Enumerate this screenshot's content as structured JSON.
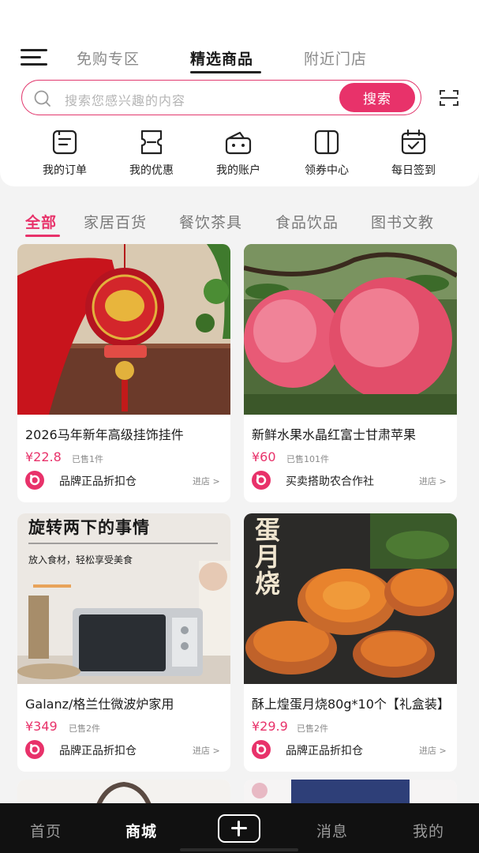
{
  "header": {
    "tabs": [
      {
        "label": "免购专区",
        "active": false
      },
      {
        "label": "精选商品",
        "active": true
      },
      {
        "label": "附近门店",
        "active": false
      }
    ]
  },
  "search": {
    "placeholder": "搜索您感兴趣的内容",
    "button_label": "搜索"
  },
  "quick_actions": [
    {
      "label": "我的订单",
      "icon": "order-icon"
    },
    {
      "label": "我的优惠",
      "icon": "coupon-icon"
    },
    {
      "label": "我的账户",
      "icon": "wallet-icon"
    },
    {
      "label": "领券中心",
      "icon": "ticket-icon"
    },
    {
      "label": "每日签到",
      "icon": "calendar-check-icon"
    }
  ],
  "categories": [
    {
      "label": "全部",
      "active": true
    },
    {
      "label": "家居百货",
      "active": false
    },
    {
      "label": "餐饮茶具",
      "active": false
    },
    {
      "label": "食品饮品",
      "active": false
    },
    {
      "label": "图书文教",
      "active": false
    }
  ],
  "products": [
    {
      "title": "2026马年新年高级挂饰挂件",
      "price": "¥22.8",
      "sold": "已售1件",
      "store": "品牌正品折扣仓",
      "enter": "进店 >"
    },
    {
      "title": "新鲜水果水晶红富士甘肃苹果",
      "price": "¥60",
      "sold": "已售101件",
      "store": "买卖搭助农合作社",
      "enter": "进店 >"
    },
    {
      "title": "Galanz/格兰仕微波炉家用",
      "price": "¥349",
      "sold": "已售2件",
      "store": "品牌正品折扣仓",
      "enter": "进店 >",
      "image_text": {
        "headline": "旋转两下的事情",
        "subline": "放入食材，轻松享受美食"
      }
    },
    {
      "title": "酥上煌蛋月烧80g*10个【礼盒装】",
      "price": "¥29.9",
      "sold": "已售2件",
      "store": "品牌正品折扣仓",
      "enter": "进店 >",
      "image_text": {
        "headline": "蛋月烧"
      }
    }
  ],
  "bottom_nav": [
    {
      "label": "首页",
      "active": false
    },
    {
      "label": "商城",
      "active": true
    },
    {
      "label": "消息",
      "active": false
    },
    {
      "label": "我的",
      "active": false
    }
  ],
  "colors": {
    "accent": "#e8326a",
    "nav_background": "#111111",
    "page_background": "#f3f3f3"
  }
}
